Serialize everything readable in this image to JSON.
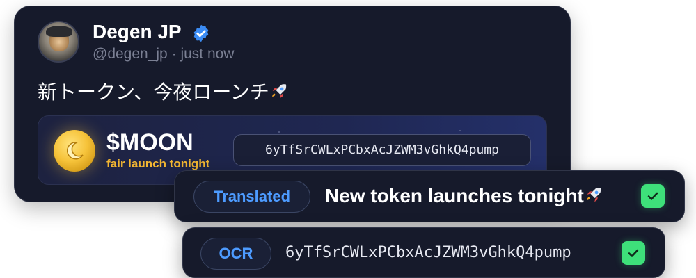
{
  "tweet": {
    "author_name": "Degen JP",
    "author_handle": "@degen_jp",
    "separator": "·",
    "timestamp": "just now",
    "text": "新トークン、今夜ローンチ",
    "verified": true,
    "avatar_icon": "dog-avatar",
    "emoji_icon": "rocket-icon"
  },
  "token": {
    "symbol": "$MOON",
    "tagline": "fair launch tonight",
    "contract_address": "6yTfSrCWLxPCbxAcJZWM3vGhkQ4pump",
    "coin_icon": "moon-coin-icon",
    "accent_color": "#f2b632"
  },
  "translation": {
    "badge_label": "Translated",
    "text": "New token launches tonight",
    "status_icon": "check-icon"
  },
  "ocr": {
    "badge_label": "OCR",
    "text": "6yTfSrCWLxPCbxAcJZWM3vGhkQ4pump",
    "status_icon": "check-icon"
  },
  "colors": {
    "card_bg": "#161a2b",
    "badge_text": "#4d9bff",
    "check_green": "#3ee07a",
    "verified_blue": "#3b8cf5"
  }
}
